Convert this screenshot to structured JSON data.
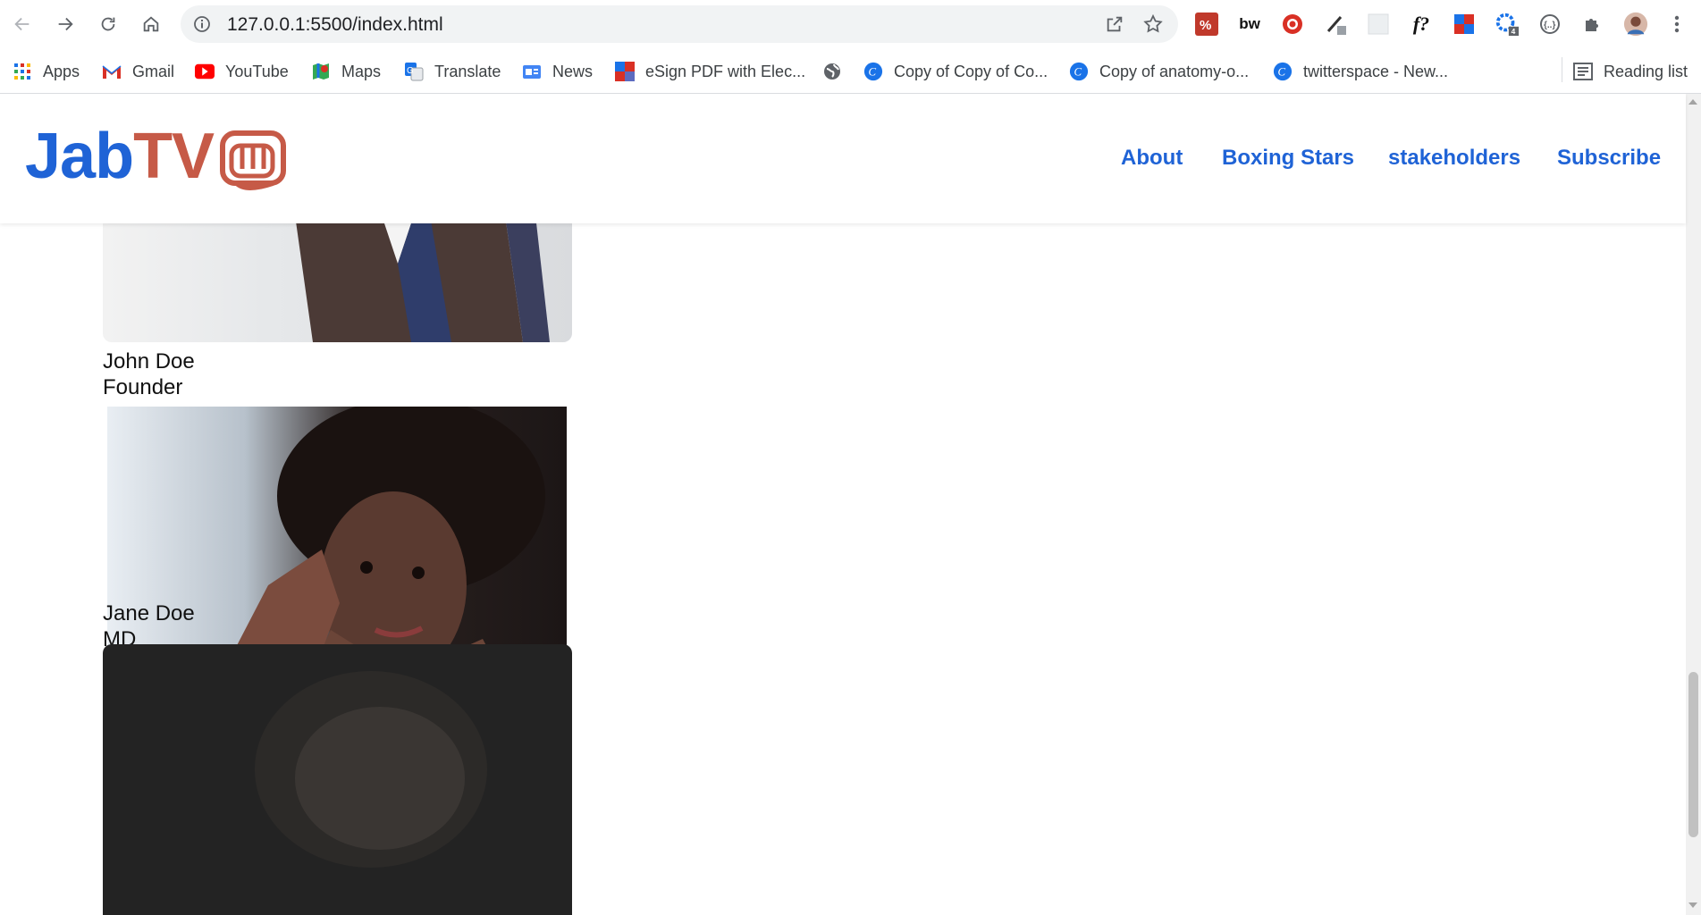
{
  "browser": {
    "url": "127.0.0.1:5500/index.html",
    "bookmarks": [
      {
        "label": "Apps",
        "icon": "apps-grid-icon"
      },
      {
        "label": "Gmail",
        "icon": "gmail-icon"
      },
      {
        "label": "YouTube",
        "icon": "youtube-icon"
      },
      {
        "label": "Maps",
        "icon": "maps-icon"
      },
      {
        "label": "Translate",
        "icon": "translate-icon"
      },
      {
        "label": "News",
        "icon": "news-icon"
      },
      {
        "label": "eSign PDF with Elec...",
        "icon": "esign-icon"
      },
      {
        "label": "",
        "icon": "globe-icon"
      },
      {
        "label": "Copy of Copy of Co...",
        "icon": "canva-icon"
      },
      {
        "label": "Copy of anatomy-o...",
        "icon": "canva-icon"
      },
      {
        "label": "twitterspace - New...",
        "icon": "canva-icon"
      }
    ],
    "reading_list": "Reading list",
    "extensions": [
      "translate-ext-icon",
      "bw-ext-icon",
      "record-ext-icon",
      "picker-ext-icon",
      "blank-ext-icon",
      "formula-ext-icon",
      "color-ext-icon",
      "gear-badge-ext-icon",
      "code-ext-icon",
      "puzzle-icon",
      "profile-avatar",
      "kebab-menu-icon"
    ],
    "ext_badge": "4",
    "ext_labels": {
      "bw": "bw",
      "formula": "f?"
    }
  },
  "site": {
    "logo_jab": "Jab",
    "logo_tv": "TV",
    "brand_blue": "#1f63d6",
    "brand_red": "#c65a47",
    "nav": [
      "About",
      "Boxing Stars",
      "stakeholders",
      "Subscribe"
    ]
  },
  "team": [
    {
      "name": "John Doe",
      "role": "Founder"
    },
    {
      "name": "Jane Doe",
      "role": "MD"
    }
  ]
}
